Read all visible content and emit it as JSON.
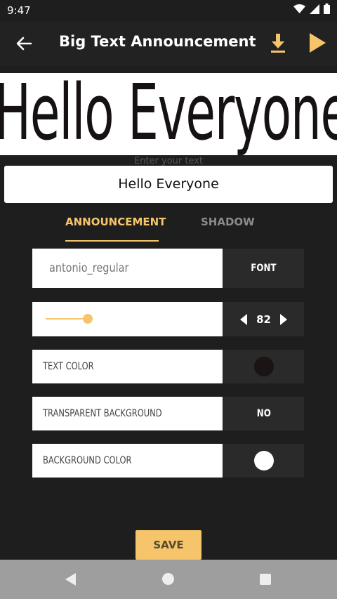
{
  "status": {
    "time": "9:47"
  },
  "appbar": {
    "title": "Big Text Announcement"
  },
  "preview": {
    "text": "Hello Everyone"
  },
  "input": {
    "hint": "Enter your text",
    "value": "Hello Everyone"
  },
  "tabs": [
    {
      "label": "ANNOUNCEMENT"
    },
    {
      "label": "SHADOW"
    }
  ],
  "font_row": {
    "font_name": "antonio_regular",
    "button_label": "FONT"
  },
  "size_row": {
    "value": "82",
    "level": 0.18
  },
  "text_color_row": {
    "label": "TEXT COLOR",
    "color": "#1a1414"
  },
  "transparent_row": {
    "label": "TRANSPARENT BACKGROUND",
    "value": "NO"
  },
  "bg_color_row": {
    "label": "BACKGROUND COLOR",
    "color": "#ffffff"
  },
  "save": {
    "label": "SAVE"
  },
  "colors": {
    "accent": "#f6c56b",
    "background": "#1e1e1e",
    "panel": "#2a2a2a"
  }
}
